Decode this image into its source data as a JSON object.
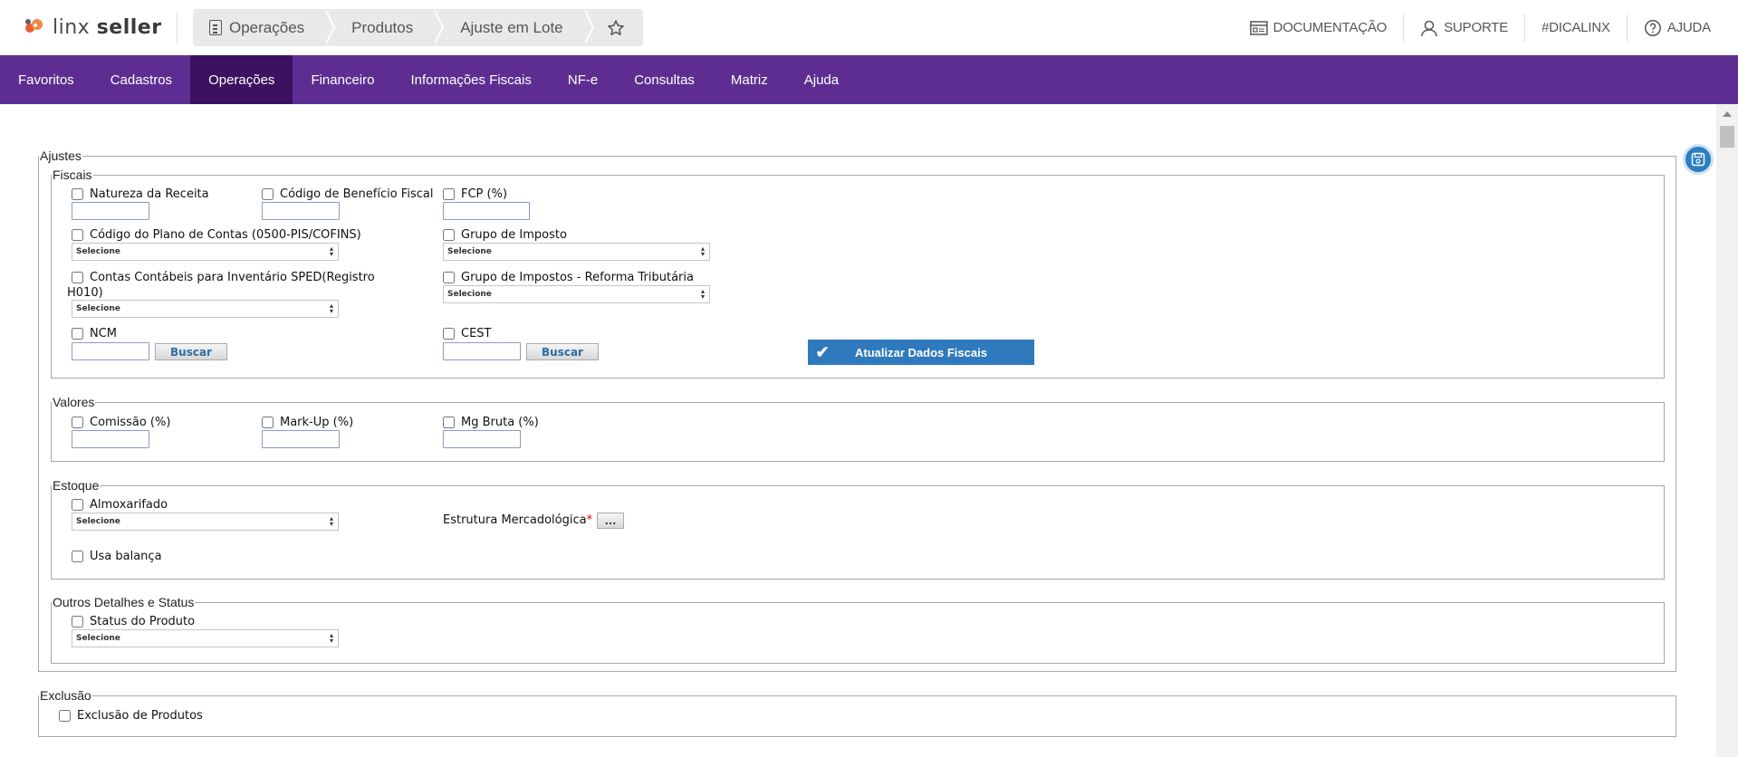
{
  "header": {
    "logo_text_light": "linx ",
    "logo_text_bold": "seller",
    "breadcrumb": [
      "Operações",
      "Produtos",
      "Ajuste em Lote"
    ],
    "star_icon": "star-icon",
    "right_links": [
      {
        "label": "DOCUMENTAÇÃO",
        "icon": "book-icon"
      },
      {
        "label": "SUPORTE",
        "icon": "user-icon"
      },
      {
        "label": "#DICALINX",
        "icon": ""
      },
      {
        "label": "AJUDA",
        "icon": "help-icon"
      }
    ]
  },
  "nav": {
    "items": [
      "Favoritos",
      "Cadastros",
      "Operações",
      "Financeiro",
      "Informações Fiscais",
      "NF-e",
      "Consultas",
      "Matriz",
      "Ajuda"
    ],
    "active": "Operações",
    "color": "#5e2d91",
    "active_color": "#3b1160"
  },
  "ajustes": {
    "legend": "Ajustes",
    "fiscais": {
      "legend": "Fiscais",
      "natureza_receita": "Natureza da Receita",
      "codigo_beneficio": "Código de Benefício Fiscal",
      "fcp": "FCP (%)",
      "plano_contas": "Código do Plano de Contas (0500-PIS/COFINS)",
      "plano_contas_select": "Selecione",
      "grupo_imposto": "Grupo de Imposto",
      "grupo_imposto_select": "Selecione",
      "contas_contabeis_line1": "Contas Contábeis para Inventário SPED(Registro",
      "contas_contabeis_line2": "H010)",
      "contas_contabeis_select": "Selecione",
      "grupo_reforma": "Grupo de Impostos - Reforma Tributária",
      "grupo_reforma_select": "Selecione",
      "ncm": "NCM",
      "ncm_buscar": "Buscar",
      "cest": "CEST",
      "cest_buscar": "Buscar",
      "atualizar": "Atualizar Dados Fiscais"
    },
    "valores": {
      "legend": "Valores",
      "comissao": "Comissão (%)",
      "markup": "Mark-Up (%)",
      "mg_bruta": "Mg Bruta (%)"
    },
    "estoque": {
      "legend": "Estoque",
      "almoxarifado": "Almoxarifado",
      "almoxarifado_select": "Selecione",
      "estrutura": "Estrutura Mercadológica",
      "estrutura_required": "*",
      "dots": "...",
      "usa_balanca": "Usa balança"
    },
    "outros": {
      "legend": "Outros Detalhes e Status",
      "status_produto": "Status do Produto",
      "status_select": "Selecione"
    }
  },
  "exclusao": {
    "legend": "Exclusão",
    "exclusao_produtos": "Exclusão de Produtos"
  }
}
